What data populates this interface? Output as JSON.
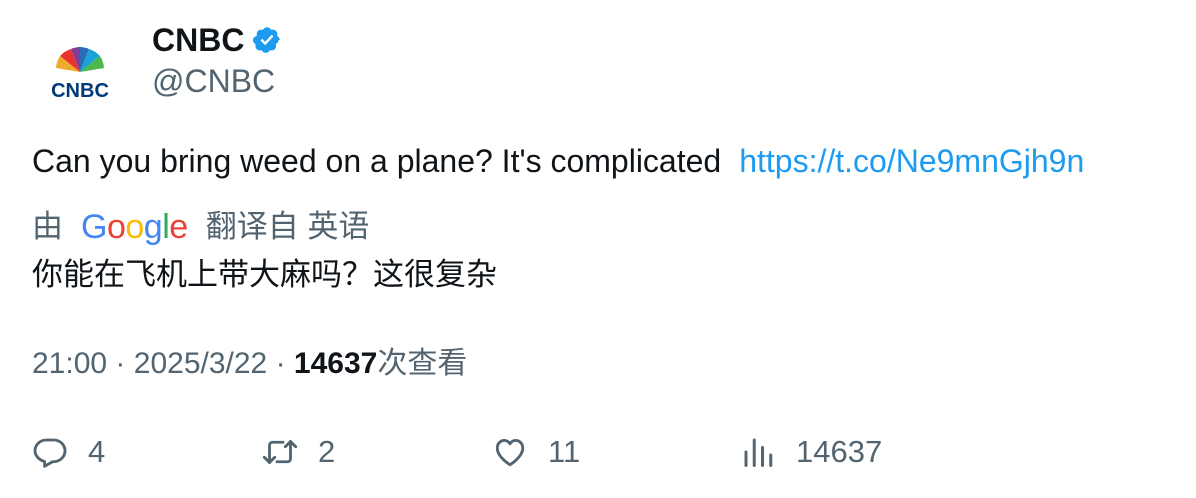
{
  "author": {
    "display_name": "CNBC",
    "handle": "@CNBC",
    "avatar_text": "CNBC",
    "verified_icon": "verified-badge-icon"
  },
  "tweet": {
    "text": "Can you bring weed on a plane? It's complicated",
    "link": "https://t.co/Ne9mnGjh9n"
  },
  "translation": {
    "prefix": "由",
    "provider": "Google",
    "suffix": "翻译自 英语",
    "text": "你能在飞机上带大麻吗？这很复杂"
  },
  "meta": {
    "time": "21:00",
    "separator": "·",
    "date": "2025/3/22",
    "views_count": "14637",
    "views_label": "次查看"
  },
  "actions": {
    "replies": "4",
    "retweets": "2",
    "likes": "11",
    "views": "14637"
  },
  "colors": {
    "link": "#1d9bf0",
    "secondary_text": "#536471",
    "primary_text": "#0f1419",
    "verified": "#1d9bf0"
  }
}
